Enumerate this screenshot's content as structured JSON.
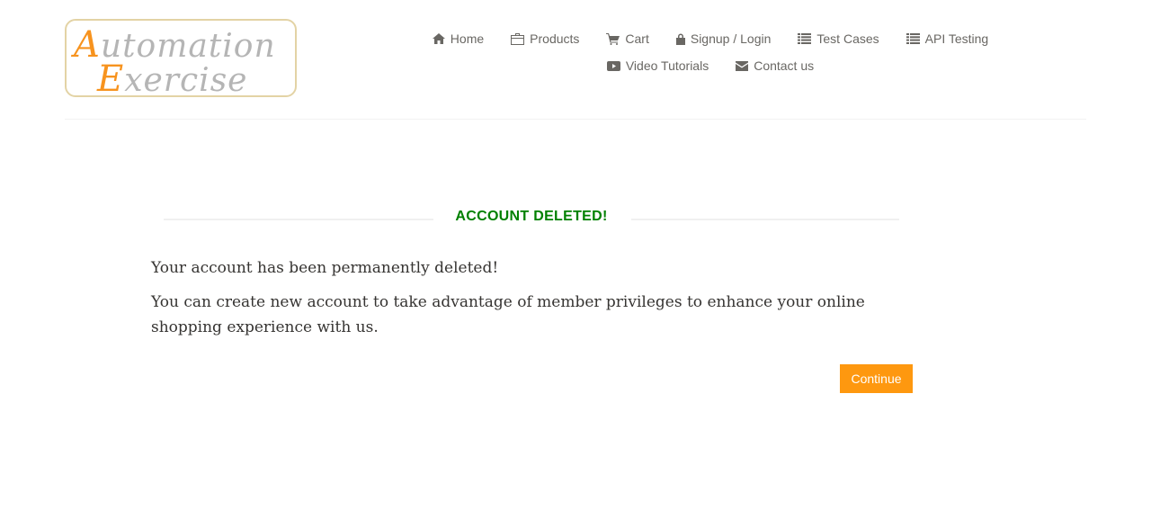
{
  "logo": {
    "line1_cap": "A",
    "line1_rest": "utomation",
    "line2_cap": "E",
    "line2_rest": "xercise"
  },
  "nav": {
    "row1": [
      {
        "label": "Home",
        "icon": "home-icon"
      },
      {
        "label": "Products",
        "icon": "products-icon"
      },
      {
        "label": "Cart",
        "icon": "cart-icon"
      },
      {
        "label": "Signup / Login",
        "icon": "lock-icon"
      },
      {
        "label": "Test Cases",
        "icon": "list-icon"
      },
      {
        "label": "API Testing",
        "icon": "list-icon"
      }
    ],
    "row2": [
      {
        "label": "Video Tutorials",
        "icon": "video-icon"
      },
      {
        "label": "Contact us",
        "icon": "envelope-icon"
      }
    ]
  },
  "main": {
    "title": "ACCOUNT DELETED!",
    "message1": "Your account has been permanently deleted!",
    "message2": "You can create new account to take advantage of member privileges to enhance your online shopping experience with us.",
    "continue_label": "Continue"
  },
  "colors": {
    "accent": "#fe980f",
    "title": "#008000",
    "nav_text": "#696763"
  }
}
